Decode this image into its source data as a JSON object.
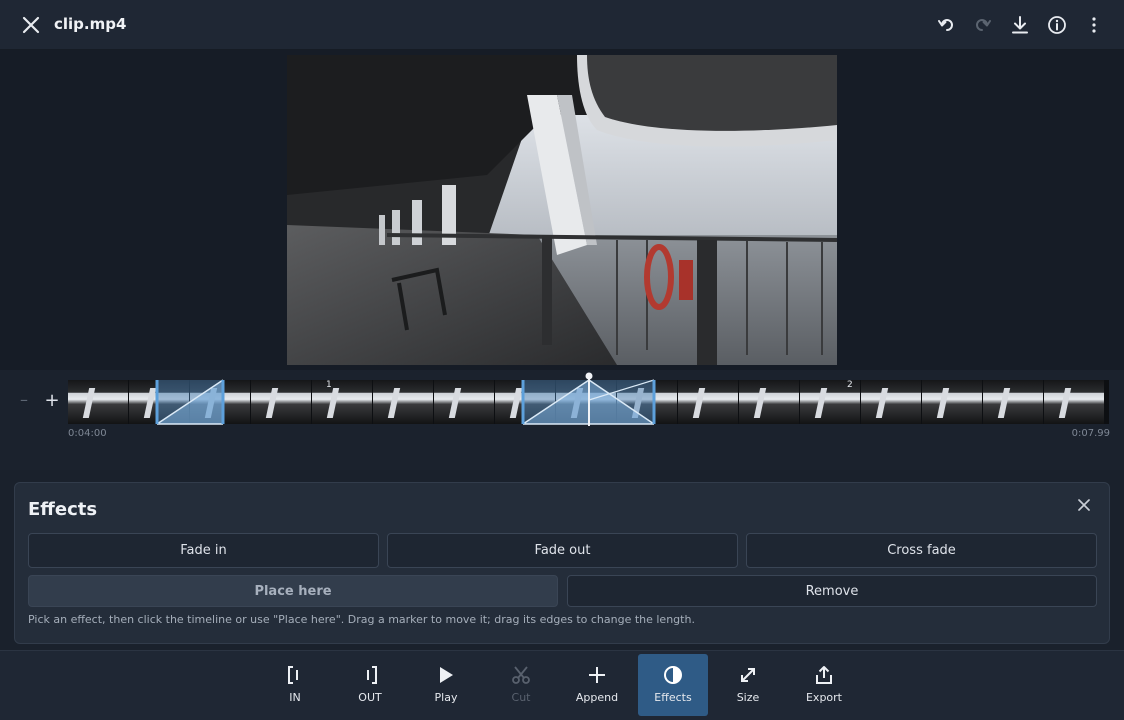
{
  "header": {
    "title": "clip.mp4",
    "actions": [
      "undo-icon",
      "redo-icon",
      "download-icon",
      "info-icon",
      "more-vert-icon"
    ]
  },
  "timeline": {
    "start_time": "0:04:00",
    "end_time": "0:07.99",
    "markers": [
      "1",
      "2"
    ]
  },
  "effects_panel": {
    "title": "Effects",
    "fade_in_label": "Fade in",
    "fade_out_label": "Fade out",
    "cross_fade_label": "Cross fade",
    "place_here_label": "Place here",
    "remove_label": "Remove",
    "hint": "Pick an effect, then click the timeline or use \"Place here\". Drag a marker to move it; drag its edges to change the length."
  },
  "toolbar": {
    "in_label": "IN",
    "out_label": "OUT",
    "play_label": "Play",
    "cut_label": "Cut",
    "append_label": "Append",
    "effects_label": "Effects",
    "size_label": "Size",
    "export_label": "Export"
  },
  "colors": {
    "accent": "#2f5b86",
    "effect_marker": "#7fb2e0",
    "background": "#1a212c"
  }
}
